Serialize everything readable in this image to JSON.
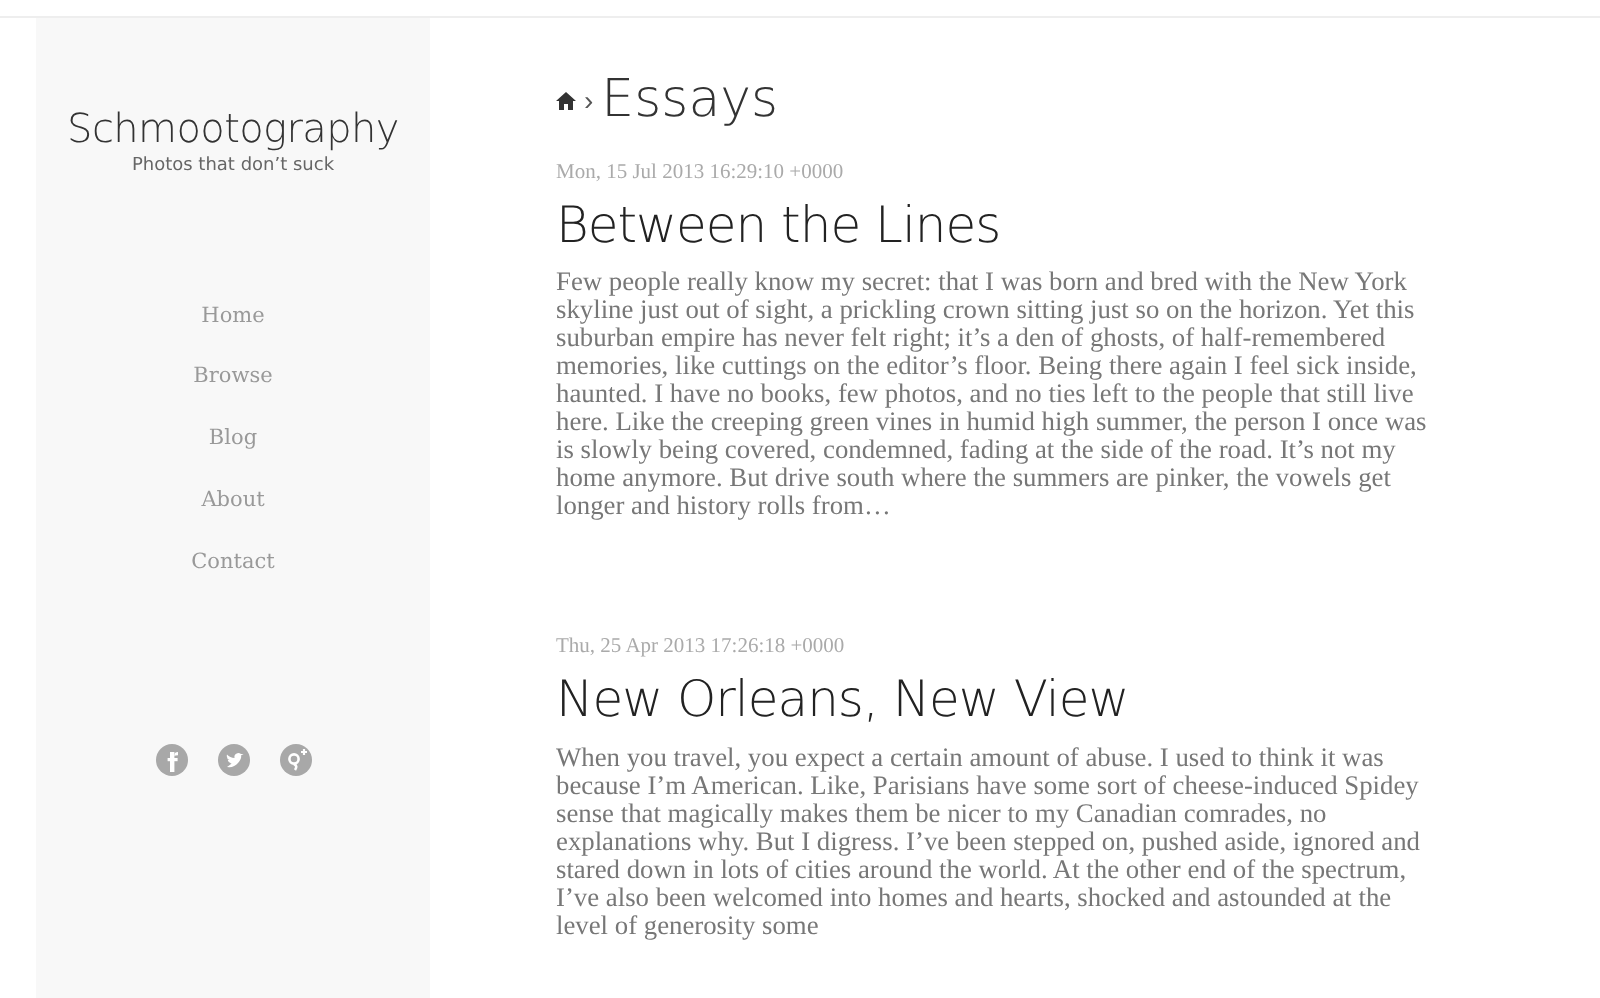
{
  "site": {
    "title": "Schmootography",
    "tagline": "Photos that don’t suck"
  },
  "nav": [
    {
      "label": "Home"
    },
    {
      "label": "Browse"
    },
    {
      "label": "Blog"
    },
    {
      "label": "About"
    },
    {
      "label": "Contact"
    }
  ],
  "social": [
    {
      "kind": "facebook"
    },
    {
      "kind": "twitter"
    },
    {
      "kind": "googleplus"
    }
  ],
  "breadcrumb": {
    "separator": "›",
    "title": "Essays"
  },
  "posts": [
    {
      "date": "Mon, 15 Jul 2013 16:29:10 +0000",
      "title": "Between the Lines",
      "excerpt": "Few people really know my secret: that I was born and bred with the New York skyline just out of sight, a prickling crown sitting just so on the horizon. Yet this suburban empire has never felt right; it’s a den of ghosts, of half-remembered memories, like cuttings on the editor’s floor. Being there again I feel sick inside, haunted. I have no books, few photos, and no ties left to the people that still live here. Like the creeping green vines in humid high summer, the person I once was is slowly being covered, condemned, fading at the side of the road. It’s not my home anymore. But drive south where the summers are pinker, the vowels get longer and history rolls from…"
    },
    {
      "date": "Thu, 25 Apr 2013 17:26:18 +0000",
      "title": "New Orleans, New View",
      "excerpt": "When you travel, you expect a certain amount of abuse. I used to think it was because I’m American. Like, Parisians have some sort of cheese-induced Spidey sense that magically makes them be nicer to my Canadian comrades, no explanations why. But I digress. I’ve been stepped on, pushed aside, ignored and stared down in lots of cities around the world. At the other end of the spectrum, I’ve also been welcomed into homes and hearts, shocked and astounded at the level of generosity some"
    }
  ]
}
